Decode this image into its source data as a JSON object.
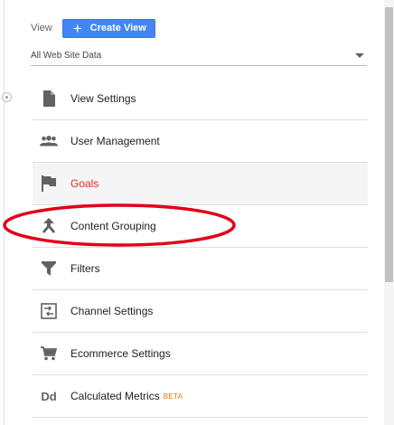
{
  "header": {
    "view_label": "View",
    "create_button_label": "Create View",
    "create_button_icon": "plus-icon",
    "accent_color": "#4285f4"
  },
  "view_selector": {
    "value": "All Web Site Data",
    "icon": "dropdown-caret-icon"
  },
  "menu": {
    "items": [
      {
        "label": "View Settings",
        "icon": "document-icon",
        "active": false
      },
      {
        "label": "User Management",
        "icon": "people-icon",
        "active": false
      },
      {
        "label": "Goals",
        "icon": "flag-icon",
        "active": true
      },
      {
        "label": "Content Grouping",
        "icon": "merge-arrow-icon",
        "active": false
      },
      {
        "label": "Filters",
        "icon": "funnel-icon",
        "active": false
      },
      {
        "label": "Channel Settings",
        "icon": "channel-icon",
        "active": false
      },
      {
        "label": "Ecommerce Settings",
        "icon": "cart-icon",
        "active": false
      },
      {
        "label": "Calculated Metrics",
        "badge": "BETA",
        "icon": "dd-icon",
        "icon_text": "Dd",
        "active": false
      }
    ],
    "active_color": "#d93025",
    "badge_color": "#e37400"
  },
  "annotation": {
    "shape": "ellipse",
    "color": "#e1001a",
    "target": "Content Grouping"
  }
}
